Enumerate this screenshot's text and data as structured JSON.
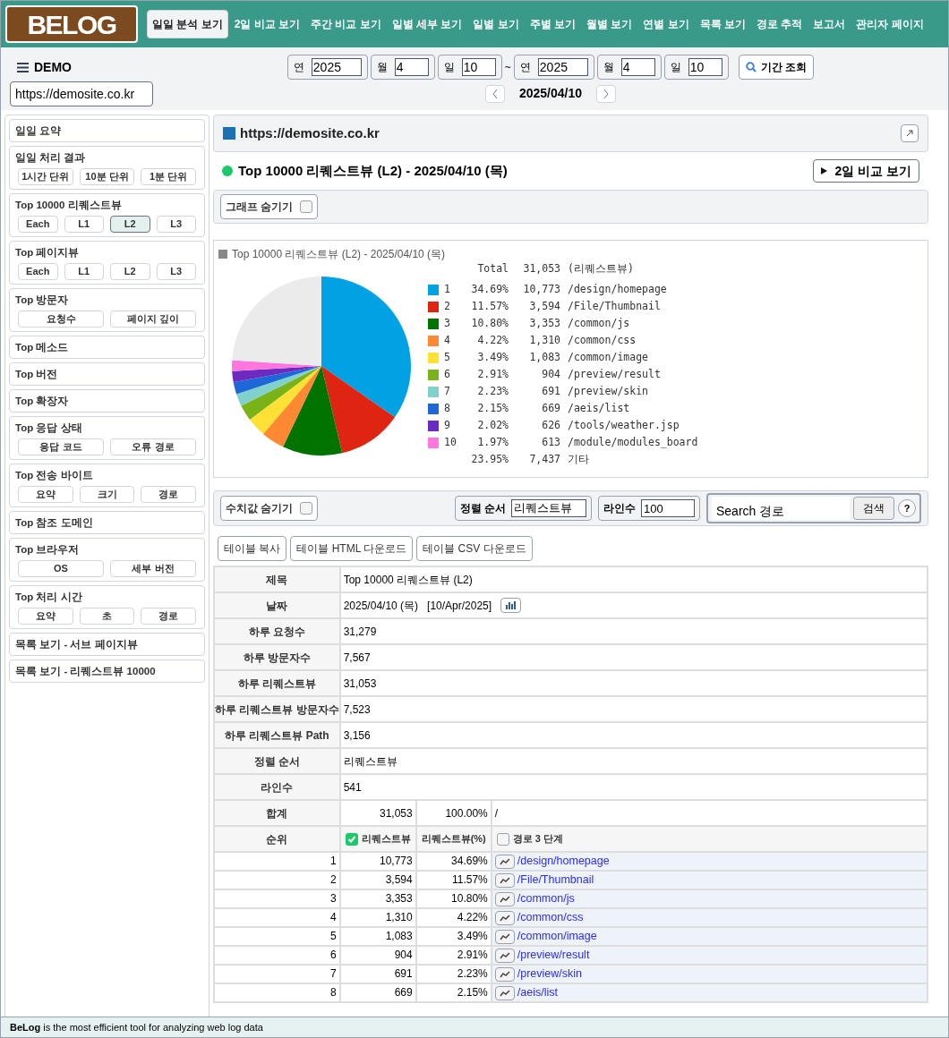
{
  "logo": "BELOG",
  "nav": [
    {
      "label": "일일 분석 보기",
      "selected": true
    },
    {
      "label": "2일 비교 보기",
      "selected": false
    },
    {
      "label": "주간 비교 보기",
      "selected": false
    },
    {
      "label": "일별 세부 보기",
      "selected": false
    },
    {
      "label": "일별 보기",
      "selected": false
    },
    {
      "label": "주별 보기",
      "selected": false
    },
    {
      "label": "월별 보기",
      "selected": false
    },
    {
      "label": "연별 보기",
      "selected": false
    },
    {
      "label": "목록 보기",
      "selected": false
    },
    {
      "label": "경로 추적",
      "selected": false
    },
    {
      "label": "보고서",
      "selected": false
    },
    {
      "label": "관리자 페이지",
      "selected": false
    }
  ],
  "site": {
    "name": "DEMO",
    "url": "https://demosite.co.kr"
  },
  "date_range": {
    "separator": "~",
    "from": {
      "year_label": "연",
      "year": "2025",
      "month_label": "월",
      "month": "4",
      "day_label": "일",
      "day": "10"
    },
    "to": {
      "year_label": "연",
      "year": "2025",
      "month_label": "월",
      "month": "4",
      "day_label": "일",
      "day": "10"
    },
    "search_button": "기간 조회"
  },
  "current_date": "2025/04/10",
  "sidebar": [
    {
      "title": "일일 요약"
    },
    {
      "title": "일일 처리 결과",
      "buttons": [
        {
          "label": "1시간 단위",
          "selected": false
        },
        {
          "label": "10분 단위",
          "selected": false
        },
        {
          "label": "1분 단위",
          "selected": false
        }
      ]
    },
    {
      "title": "Top 10000 리퀘스트뷰",
      "buttons": [
        {
          "label": "Each",
          "selected": false
        },
        {
          "label": "L1",
          "selected": false
        },
        {
          "label": "L2",
          "selected": true
        },
        {
          "label": "L3",
          "selected": false
        }
      ]
    },
    {
      "title": "Top 페이지뷰",
      "buttons": [
        {
          "label": "Each",
          "selected": false
        },
        {
          "label": "L1",
          "selected": false
        },
        {
          "label": "L2",
          "selected": false
        },
        {
          "label": "L3",
          "selected": false
        }
      ]
    },
    {
      "title": "Top 방문자",
      "buttons": [
        {
          "label": "요청수",
          "selected": false
        },
        {
          "label": "페이지 깊이",
          "selected": false
        }
      ]
    },
    {
      "title": "Top 메소드"
    },
    {
      "title": "Top 버전"
    },
    {
      "title": "Top 확장자"
    },
    {
      "title": "Top 응답 상태",
      "buttons": [
        {
          "label": "응답 코드",
          "selected": false
        },
        {
          "label": "오류 경로",
          "selected": false
        }
      ]
    },
    {
      "title": "Top 전송 바이트",
      "buttons": [
        {
          "label": "요약",
          "selected": false
        },
        {
          "label": "크기",
          "selected": false
        },
        {
          "label": "경로",
          "selected": false
        }
      ]
    },
    {
      "title": "Top 참조 도메인"
    },
    {
      "title": "Top 브라우저",
      "buttons": [
        {
          "label": "OS",
          "selected": false
        },
        {
          "label": "세부 버전",
          "selected": false
        }
      ]
    },
    {
      "title": "Top 처리 시간",
      "buttons": [
        {
          "label": "요약",
          "selected": false
        },
        {
          "label": "초",
          "selected": false
        },
        {
          "label": "경로",
          "selected": false
        }
      ]
    },
    {
      "title": "목록 보기 - 서브 페이지뷰"
    },
    {
      "title": "목록 보기 - 리퀘스트뷰 10000"
    }
  ],
  "header_url": "https://demosite.co.kr",
  "report_title": "Top 10000 리퀘스트뷰 (L2) - 2025/04/10 (목)",
  "compare_button": "2일 비교 보기",
  "graph_toggle": {
    "label": "그래프 숨기기",
    "checked": false
  },
  "chart": {
    "title": "Top 10000 리퀘스트뷰 (L2) - 2025/04/10 (목)",
    "total": {
      "label": "Total",
      "value": "31,053",
      "unit": "(리퀘스트뷰)"
    },
    "legend": [
      {
        "rank": "1",
        "percent": "34.69%",
        "count": "10,773",
        "color": "#00a2e3"
      },
      {
        "rank": "2",
        "percent": "11.57%",
        "count": "3,594",
        "color": "#dd2512"
      },
      {
        "rank": "3",
        "percent": "10.80%",
        "count": "3,353",
        "color": "#007300"
      },
      {
        "rank": "4",
        "percent": "4.22%",
        "count": "1,310",
        "color": "#ff8833"
      },
      {
        "rank": "5",
        "percent": "3.49%",
        "count": "1,083",
        "color": "#ffe135"
      },
      {
        "rank": "6",
        "percent": "2.91%",
        "count": "904",
        "color": "#7ab317"
      },
      {
        "rank": "7",
        "percent": "2.23%",
        "count": "691",
        "color": "#80d0cc"
      },
      {
        "rank": "8",
        "percent": "2.15%",
        "count": "669",
        "color": "#1d68d6"
      },
      {
        "rank": "9",
        "percent": "2.02%",
        "count": "626",
        "color": "#6b2bc0"
      },
      {
        "rank": "10",
        "percent": "1.97%",
        "count": "613",
        "color": "#ff77dd"
      },
      {
        "percent": "23.95%",
        "count": "7,437"
      }
    ],
    "chart_data": {
      "type": "pie",
      "categories": [
        "/design/homepage",
        "/File/Thumbnail",
        "/common/js",
        "/common/css",
        "/common/image",
        "/preview/result",
        "/preview/skin",
        "/aeis/list",
        "/tools/weather.jsp",
        "/module/modules_board",
        "기타"
      ],
      "values": [
        34.69,
        11.57,
        10.8,
        4.22,
        3.49,
        2.91,
        2.23,
        2.15,
        2.02,
        1.97,
        23.95
      ]
    }
  },
  "controls": {
    "value_toggle": {
      "label": "수치값 숨기기",
      "checked": false
    },
    "sort": {
      "label": "정렬 순서",
      "value": "리퀘스트뷰"
    },
    "lines": {
      "label": "라인수",
      "value": "100"
    },
    "search": {
      "placeholder": "Search 경로",
      "button": "검색",
      "help": "?"
    }
  },
  "table_buttons": [
    "테이블 복사",
    "테이블 HTML 다운로드",
    "테이블 CSV 다운로드"
  ],
  "info_rows": [
    {
      "label": "제목",
      "value": "Top 10000 리퀘스트뷰 (L2)",
      "kind": "text"
    },
    {
      "label": "날짜",
      "value": "2025/04/10 (목)",
      "extra": "[10/Apr/2025]",
      "kind": "date"
    },
    {
      "label": "하루 요청수",
      "value": "31,279",
      "kind": "text"
    },
    {
      "label": "하루 방문자수",
      "value": "7,567",
      "kind": "text"
    },
    {
      "label": "하루 리퀘스트뷰",
      "value": "31,053",
      "kind": "text"
    },
    {
      "label": "하루 리퀘스트뷰 방문자수",
      "value": "7,523",
      "kind": "text"
    },
    {
      "label": "하루 리퀘스트뷰 Path",
      "value": "3,156",
      "kind": "text"
    },
    {
      "label": "정렬 순서",
      "value": "리퀘스트뷰",
      "kind": "text"
    },
    {
      "label": "라인수",
      "value": "541",
      "kind": "text"
    }
  ],
  "total_row": {
    "label": "합계",
    "count": "31,053",
    "percent": "100.00%",
    "path": "/"
  },
  "columns": [
    {
      "label": "순위",
      "kind": "plain"
    },
    {
      "label": "리퀘스트뷰",
      "kind": "check",
      "checked": true
    },
    {
      "label": "리퀘스트뷰(%)",
      "kind": "plain"
    },
    {
      "label": "경로 3 단계",
      "kind": "check",
      "checked": false
    }
  ],
  "rows": [
    {
      "rank": "1",
      "count": "10,773",
      "percent": "34.69%",
      "path": "/design/homepage"
    },
    {
      "rank": "2",
      "count": "3,594",
      "percent": "11.57%",
      "path": "/File/Thumbnail"
    },
    {
      "rank": "3",
      "count": "3,353",
      "percent": "10.80%",
      "path": "/common/js"
    },
    {
      "rank": "4",
      "count": "1,310",
      "percent": "4.22%",
      "path": "/common/css"
    },
    {
      "rank": "5",
      "count": "1,083",
      "percent": "3.49%",
      "path": "/common/image"
    },
    {
      "rank": "6",
      "count": "904",
      "percent": "2.91%",
      "path": "/preview/result"
    },
    {
      "rank": "7",
      "count": "691",
      "percent": "2.23%",
      "path": "/preview/skin"
    },
    {
      "rank": "8",
      "count": "669",
      "percent": "2.15%",
      "path": "/aeis/list"
    }
  ],
  "footer": {
    "brand": "BeLog",
    "text": "is the most efficient tool for analyzing web log data"
  }
}
